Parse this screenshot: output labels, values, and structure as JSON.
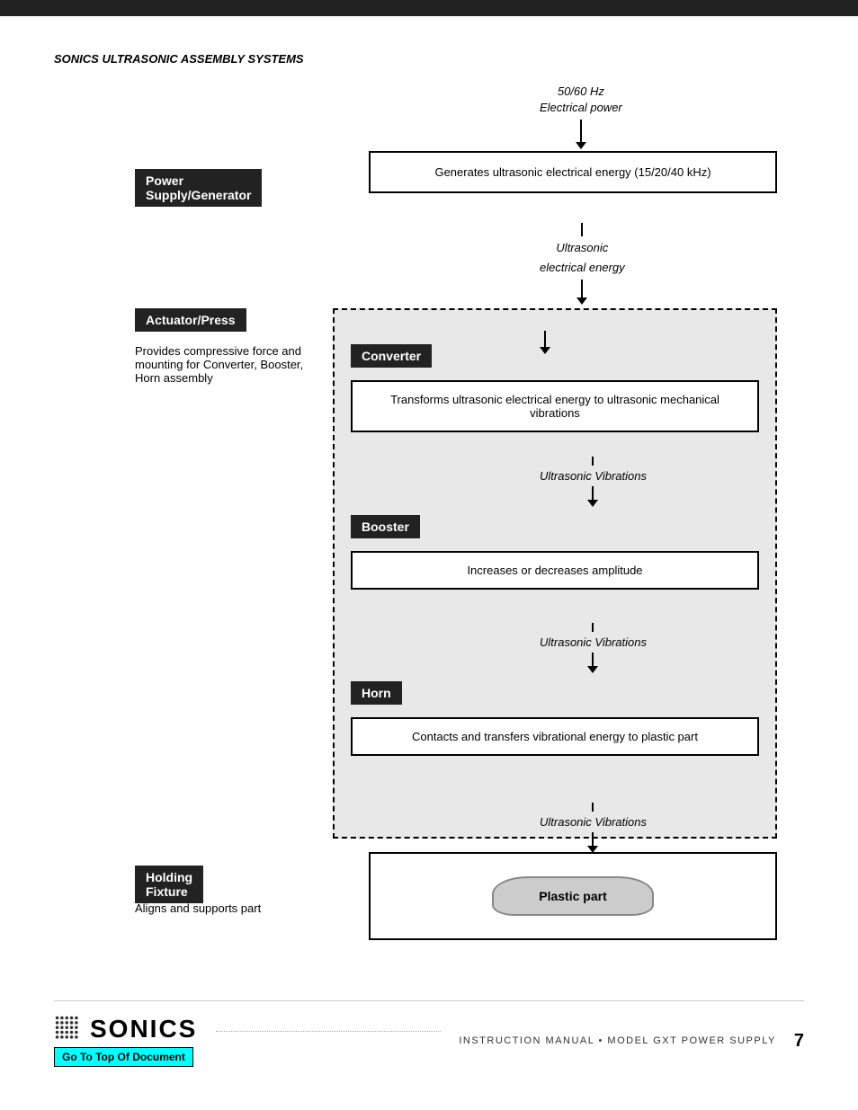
{
  "topbar": {},
  "page": {
    "title": "SONICS ULTRASONIC ASSEMBLY SYSTEMS",
    "footer": {
      "logo_text": "SONICS",
      "go_to_top": "Go To Top Of Document",
      "manual_text": "INSTRUCTION MANUAL  •  MODEL GXT POWER SUPPLY",
      "page_number": "7"
    }
  },
  "diagram": {
    "power_supply": {
      "label": "Power Supply/Generator",
      "arrow_in_label": "50/60 Hz",
      "arrow_in_label2": "Electrical power",
      "desc": "Generates ultrasonic electrical energy (15/20/40 kHz)"
    },
    "actuator": {
      "label": "Actuator/Press",
      "desc": "Provides compressive force and mounting for Converter, Booster, Horn assembly",
      "arrow_label": "Ultrasonic",
      "arrow_label2": "electrical energy"
    },
    "converter": {
      "label": "Converter",
      "desc": "Transforms ultrasonic electrical energy to ultrasonic mechanical vibrations"
    },
    "booster": {
      "label": "Booster",
      "desc": "Increases or decreases amplitude",
      "arrow_label": "Ultrasonic Vibrations"
    },
    "horn": {
      "label": "Horn",
      "desc": "Contacts and transfers vibrational energy to plastic part",
      "arrow_label": "Ultrasonic Vibrations"
    },
    "holding_fixture": {
      "label": "Holding Fixture",
      "desc": "Aligns and supports part",
      "arrow_label": "Ultrasonic Vibrations"
    },
    "plastic_part": {
      "label": "Plastic part"
    }
  }
}
